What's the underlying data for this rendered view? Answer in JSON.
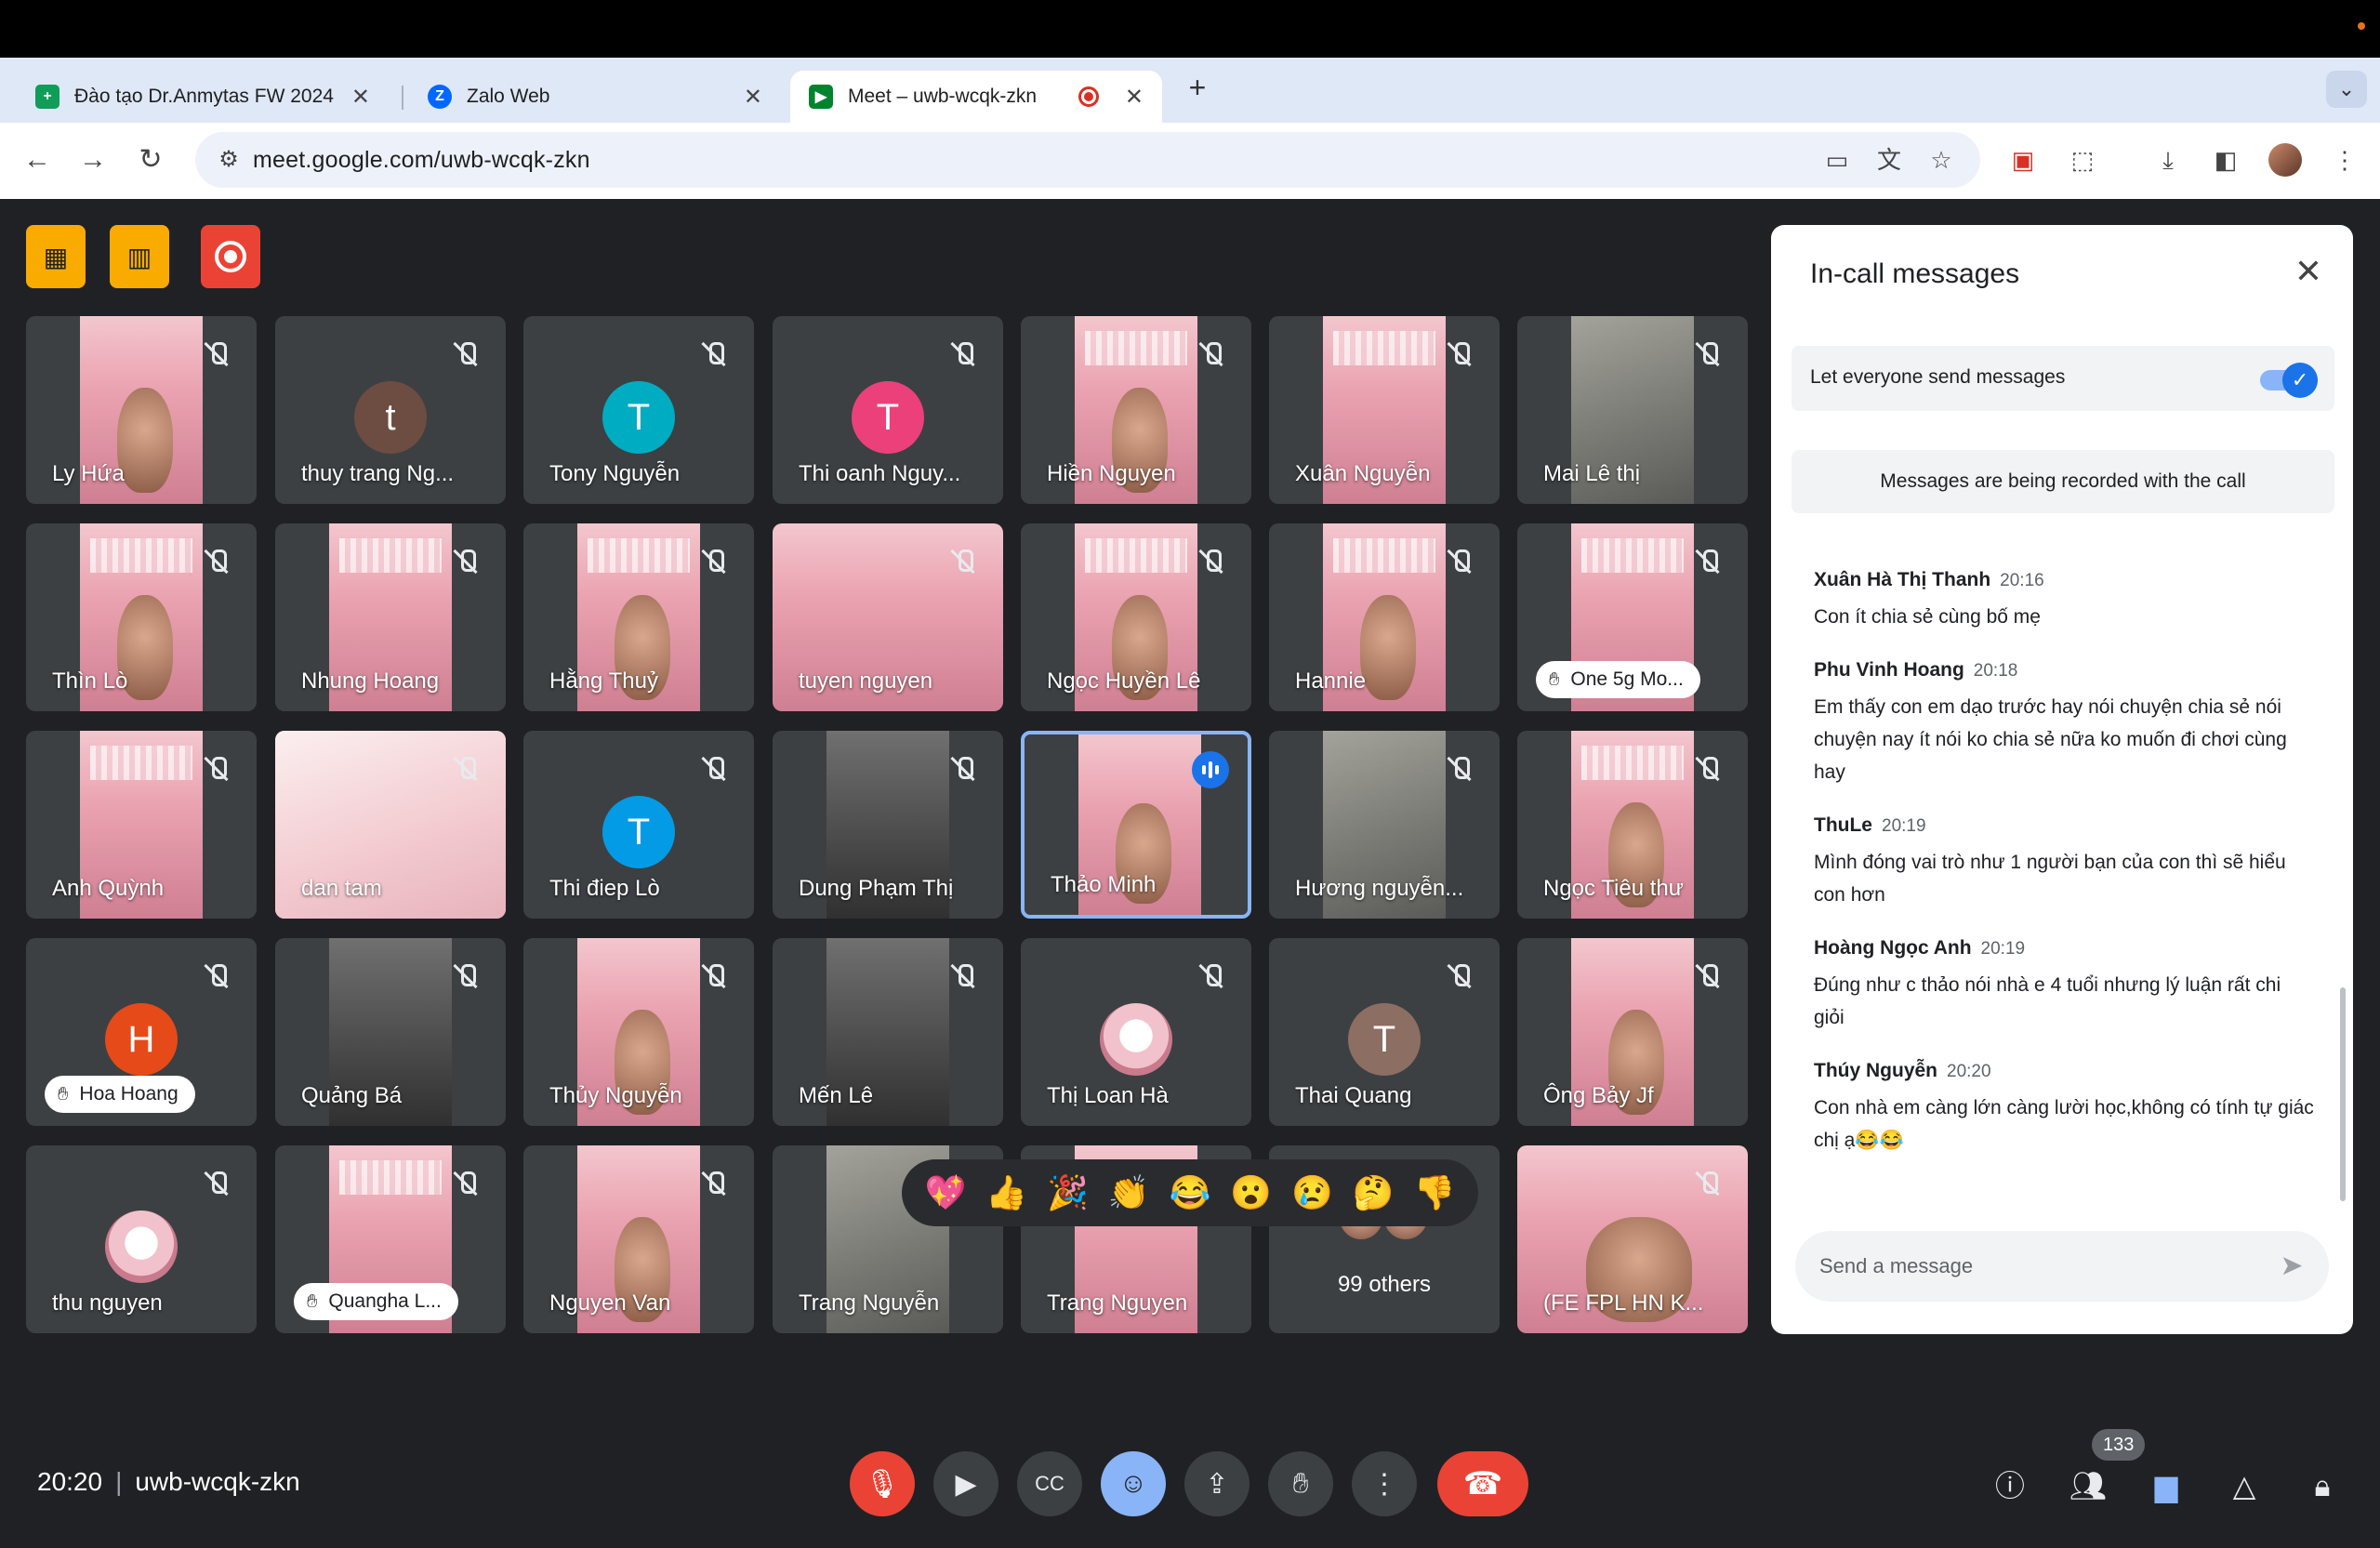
{
  "browser": {
    "tabs": [
      {
        "label": "Đào tạo Dr.Anmytas FW 2024",
        "favicon": "sheets-icon",
        "color": "#0f9d58"
      },
      {
        "label": "Zalo Web",
        "favicon": "zalo-icon",
        "color": "#0068ff"
      },
      {
        "label": "Meet – uwb-wcqk-zkn",
        "favicon": "meet-icon",
        "color": "#00832d"
      }
    ],
    "url": "meet.google.com/uwb-wcqk-zkn"
  },
  "meeting": {
    "time": "20:20",
    "code": "uwb-wcqk-zkn",
    "participant_count": "133"
  },
  "tiles": [
    {
      "name": "Ly Hứa"
    },
    {
      "name": "thuy trang Ng...",
      "avatar_letter": "t",
      "avatar_color": "#6d4c41"
    },
    {
      "name": "Tony Nguyễn",
      "avatar_letter": "T",
      "avatar_color": "#00acc1"
    },
    {
      "name": "Thi oanh Nguy...",
      "avatar_letter": "T",
      "avatar_color": "#ec407a"
    },
    {
      "name": "Hiền Nguyen"
    },
    {
      "name": "Xuân Nguyễn"
    },
    {
      "name": "Mai Lê thị"
    },
    {
      "name": "Thìn Lò"
    },
    {
      "name": "Nhung Hoang"
    },
    {
      "name": "Hằng Thuỷ"
    },
    {
      "name": "tuyen nguyen"
    },
    {
      "name": "Ngọc Huyền Lê"
    },
    {
      "name": "Hannie"
    },
    {
      "name": "One 5g Mo..."
    },
    {
      "name": "Anh Quỳnh"
    },
    {
      "name": "dan tam"
    },
    {
      "name": "Thi điep Lò",
      "avatar_letter": "T",
      "avatar_color": "#039be5"
    },
    {
      "name": "Dung Phạm Thị"
    },
    {
      "name": "Thảo Minh"
    },
    {
      "name": "Hương nguyễn..."
    },
    {
      "name": "Ngọc Tiêu thư"
    },
    {
      "name": "Hoa Hoang",
      "avatar_letter": "H",
      "avatar_color": "#e64a19"
    },
    {
      "name": "Quảng Bá"
    },
    {
      "name": "Thủy Nguyễn"
    },
    {
      "name": "Mến Lê"
    },
    {
      "name": "Thị Loan Hà"
    },
    {
      "name": "Thai Quang",
      "avatar_letter": "T",
      "avatar_color": "#8d6e63"
    },
    {
      "name": "Ông Bảy Jf"
    },
    {
      "name": "thu nguyen"
    },
    {
      "name": "Quangha L..."
    },
    {
      "name": "Nguyen Van"
    },
    {
      "name": "Trang Nguyễn"
    },
    {
      "name": "Trang Nguyen"
    },
    {
      "name": "99 others"
    },
    {
      "name": "(FE FPL HN K..."
    }
  ],
  "reactions": [
    "💖",
    "👍",
    "🎉",
    "👏",
    "😂",
    "😮",
    "😢",
    "🤔",
    "👎"
  ],
  "panel": {
    "title": "In-call messages",
    "toggle_label": "Let everyone send messages",
    "toggle_on": true,
    "notice": "Messages are being recorded with the call",
    "messages": [
      {
        "sender": "Xuân Hà Thị Thanh",
        "time": "20:16",
        "text": "Con ít chia sẻ cùng bố mẹ"
      },
      {
        "sender": "Phu Vinh Hoang",
        "time": "20:18",
        "text": "Em thấy  con em dạo trước hay nói chuyện  chia sẻ nói  chuyện  nay ít nói ko chia sẻ  nữa ko muốn đi chơi cùng hay"
      },
      {
        "sender": "ThuLe",
        "time": "20:19",
        "text": "Mình đóng vai trò như 1 người bạn của con thì sẽ hiểu con hơn"
      },
      {
        "sender": "Hoàng Ngọc Anh",
        "time": "20:19",
        "text": "Đúng như c thảo nói nhà e 4 tuổi nhưng lý luận rất chi giỏi"
      },
      {
        "sender": "Thúy Nguyễn",
        "time": "20:20",
        "text": "Con nhà em càng lớn càng lười học,không có tính tự giác chị ạ😂😂"
      }
    ],
    "input_placeholder": "Send a message"
  },
  "colors": {
    "meet_bg": "#202124",
    "tile_bg": "#3c4043",
    "accent_blue": "#8ab4f8",
    "end_call_red": "#ea4335",
    "tool_yellow": "#f9ab00"
  }
}
